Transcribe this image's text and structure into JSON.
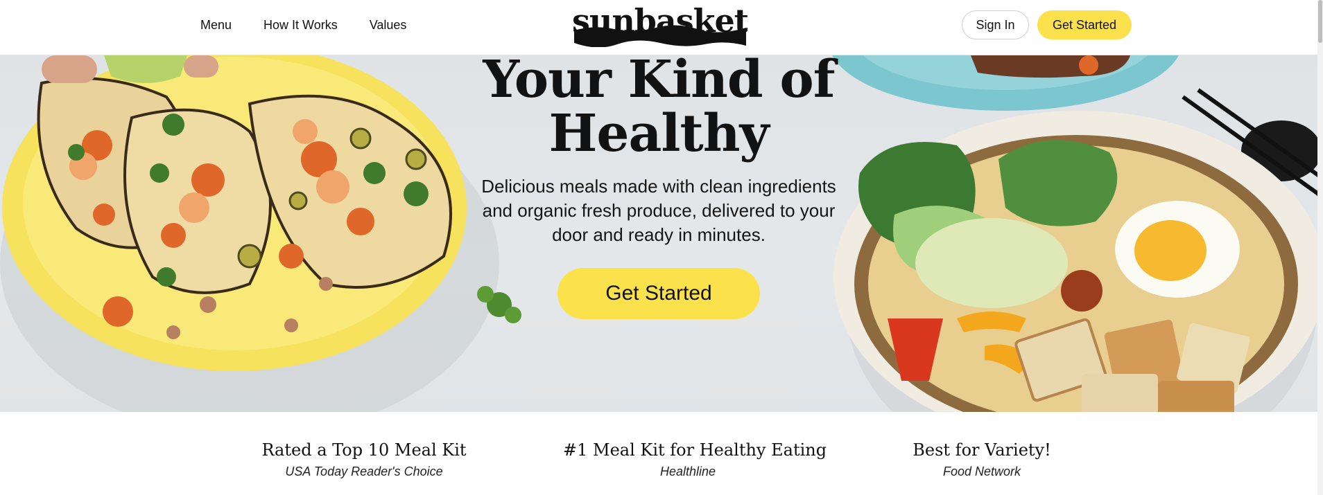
{
  "header": {
    "nav": [
      "Menu",
      "How It Works",
      "Values"
    ],
    "logo_text": "sunbasket",
    "sign_in_label": "Sign In",
    "get_started_label": "Get Started"
  },
  "hero": {
    "title_line1": "Your Kind of",
    "title_line2": "Healthy",
    "subtitle": "Delicious meals made with clean ingredients and organic fresh produce, delivered to your door and ready in minutes.",
    "cta_label": "Get Started"
  },
  "awards": [
    {
      "title": "Rated a Top 10 Meal Kit",
      "source": "USA Today Reader's Choice"
    },
    {
      "title": "#1 Meal Kit for Healthy Eating",
      "source": "Healthline"
    },
    {
      "title": "Best for Variety!",
      "source": "Food Network"
    }
  ],
  "colors": {
    "accent_yellow": "#fbe14b",
    "hero_background": "#e3e6e8",
    "text": "#111111"
  },
  "icons": [
    "sunbasket-logo",
    "taco-plate-image",
    "noodle-bowl-image",
    "chopsticks-image",
    "cilantro-leaf-image"
  ]
}
